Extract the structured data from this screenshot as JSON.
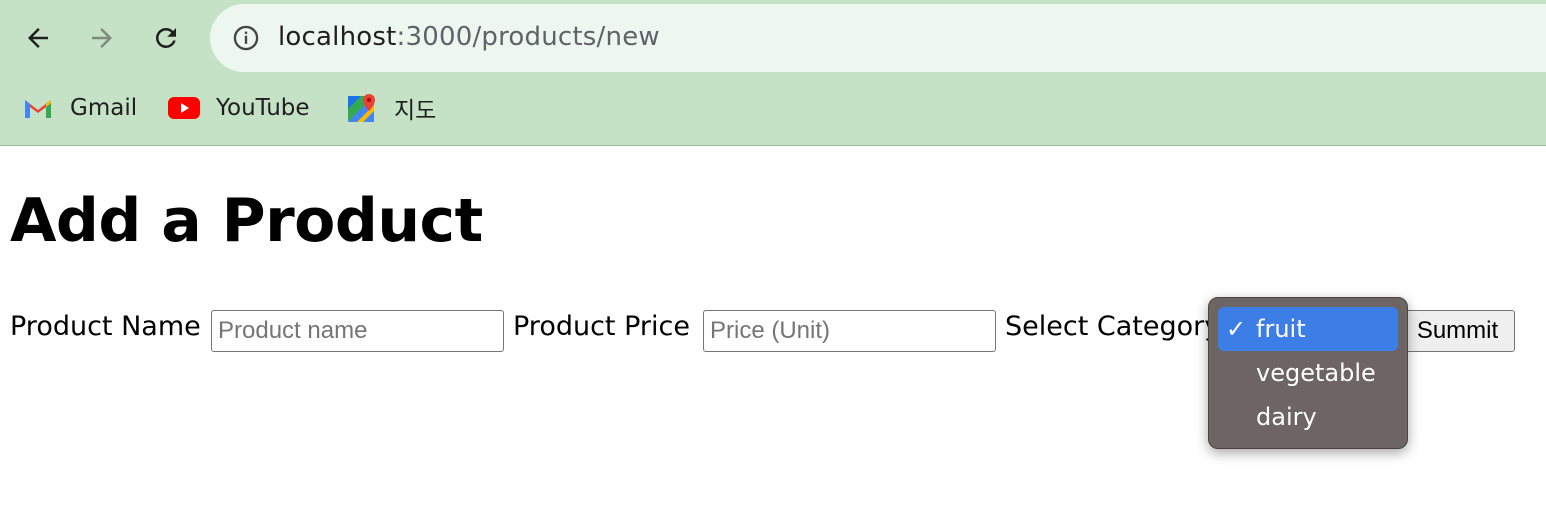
{
  "browser": {
    "url_host": "localhost",
    "url_path": ":3000/products/new",
    "icons": {
      "back": "back-arrow-icon",
      "forward": "forward-arrow-icon",
      "reload": "reload-icon",
      "site_info": "info-icon"
    },
    "bookmarks": [
      {
        "label": "Gmail",
        "icon": "gmail-icon"
      },
      {
        "label": "YouTube",
        "icon": "youtube-icon"
      },
      {
        "label": "지도",
        "icon": "maps-icon"
      }
    ]
  },
  "page": {
    "title": "Add a Product",
    "form": {
      "name_label": "Product Name",
      "name_placeholder": "Product name",
      "price_label": "Product Price",
      "price_placeholder": "Price (Unit)",
      "category_label": "Select Category",
      "category_options": [
        {
          "label": "fruit",
          "selected": true
        },
        {
          "label": "vegetable",
          "selected": false
        },
        {
          "label": "dairy",
          "selected": false
        }
      ],
      "check_mark": "✓",
      "submit_label": "Summit"
    }
  },
  "colors": {
    "chrome_bg": "#c5e2c7",
    "omnibox_bg": "#eef7ef",
    "dropdown_bg": "#6c6564",
    "selected_option": "#3d7ee6"
  }
}
